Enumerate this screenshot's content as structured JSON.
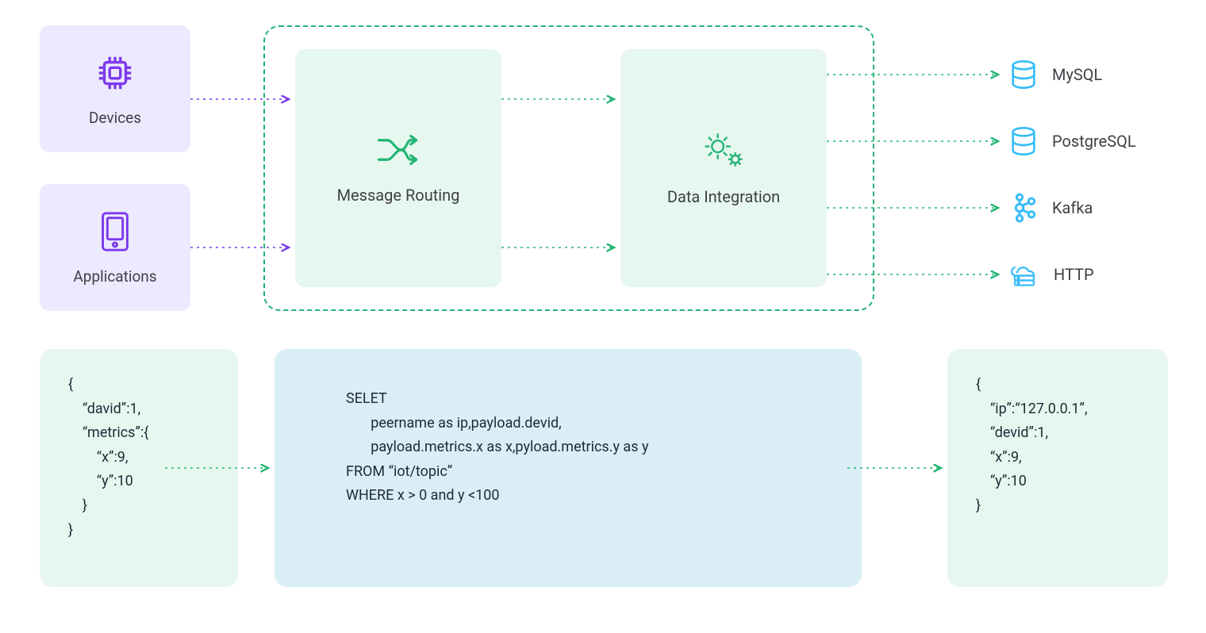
{
  "sources": {
    "devices": {
      "label": "Devices"
    },
    "applications": {
      "label": "Applications"
    }
  },
  "processors": {
    "message_routing": {
      "label": "Message Routing"
    },
    "data_integration": {
      "label": "Data Integration"
    }
  },
  "sinks": {
    "mysql": {
      "label": "MySQL"
    },
    "postgresql": {
      "label": "PostgreSQL"
    },
    "kafka": {
      "label": "Kafka"
    },
    "http": {
      "label": "HTTP"
    }
  },
  "examples": {
    "input_json": "{\n    “david”:1,\n    “metrics”:{\n        “x”:9,\n        “y”:10\n    }\n}",
    "sql": "SELET\n       peername as ip,payload.devid,\n       payload.metrics.x as x,pyload.metrics.y as y\nFROM “iot/topic”\nWHERE x > 0 and y <100",
    "output_json": "{\n    “ip”:“127.0.0.1”,\n    “devid”:1,\n    “x”:9,\n    “y”:10\n}"
  },
  "colors": {
    "purple_fill": "#ede9fe",
    "purple_stroke": "#7c3aed",
    "green_fill": "#e6f7ef",
    "green_stroke": "#22b573",
    "blue_fill": "#daeef5",
    "sky": "#38bdf8"
  }
}
